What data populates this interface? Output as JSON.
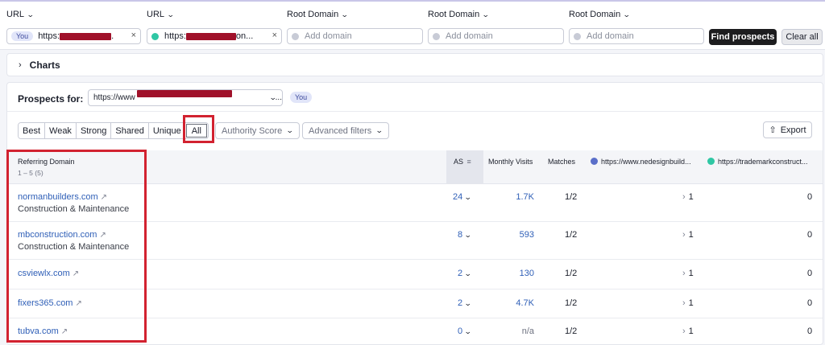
{
  "filter_bar": {
    "columns": [
      {
        "label": "URL",
        "you_tag": "You",
        "value": "https:",
        "value_tail": ".",
        "has_clear": true,
        "dot_color": ""
      },
      {
        "label": "URL",
        "you_tag": "",
        "value": "https:",
        "value_tail": "on...",
        "has_clear": true,
        "dot_color": "#2fc7a4"
      },
      {
        "label": "Root Domain",
        "placeholder": "Add domain",
        "dot_color": "#c8cbd6"
      },
      {
        "label": "Root Domain",
        "placeholder": "Add domain",
        "dot_color": "#c8cbd6"
      },
      {
        "label": "Root Domain",
        "placeholder": "Add domain",
        "dot_color": "#c8cbd6"
      }
    ],
    "find_label": "Find prospects",
    "clear_label": "Clear all",
    "clear_icon": "×"
  },
  "charts": {
    "label": "Charts",
    "arrow": "›"
  },
  "prospects": {
    "label": "Prospects for:",
    "url_start": "https://www",
    "url_end": "...",
    "you_tag": "You"
  },
  "toolbar": {
    "tabs": [
      "Best",
      "Weak",
      "Strong",
      "Shared",
      "Unique",
      "All"
    ],
    "active_tab": "All",
    "authority_label": "Authority Score",
    "advanced_label": "Advanced filters",
    "export_label": "Export",
    "export_icon": "⇧"
  },
  "table": {
    "headers": {
      "domain": "Referring Domain",
      "range": "1 – 5 (5)",
      "as": "AS",
      "visits": "Monthly Visits",
      "matches": "Matches",
      "url1": "https://www.nedesignbuild...",
      "url2": "https://trademarkconstruct..."
    },
    "rows": [
      {
        "domain": "normanbuilders.com",
        "category": "Construction & Maintenance",
        "as": "24",
        "visits": "1.7K",
        "visits_link": true,
        "matches": "1/2",
        "url1": "1",
        "url2": "0"
      },
      {
        "domain": "mbconstruction.com",
        "category": "Construction & Maintenance",
        "as": "8",
        "visits": "593",
        "visits_link": true,
        "matches": "1/2",
        "url1": "1",
        "url2": "0"
      },
      {
        "domain": "csviewlx.com",
        "category": "",
        "as": "2",
        "visits": "130",
        "visits_link": true,
        "matches": "1/2",
        "url1": "1",
        "url2": "0"
      },
      {
        "domain": "fixers365.com",
        "category": "",
        "as": "2",
        "visits": "4.7K",
        "visits_link": true,
        "matches": "1/2",
        "url1": "1",
        "url2": "0"
      },
      {
        "domain": "tubva.com",
        "category": "",
        "as": "0",
        "visits": "n/a",
        "visits_link": false,
        "matches": "1/2",
        "url1": "1",
        "url2": "0"
      }
    ]
  },
  "colors": {
    "accent_red": "#d22230",
    "link": "#2f5fb7",
    "url1_dot": "#5a6fc9",
    "url2_dot": "#2fc7a4"
  }
}
